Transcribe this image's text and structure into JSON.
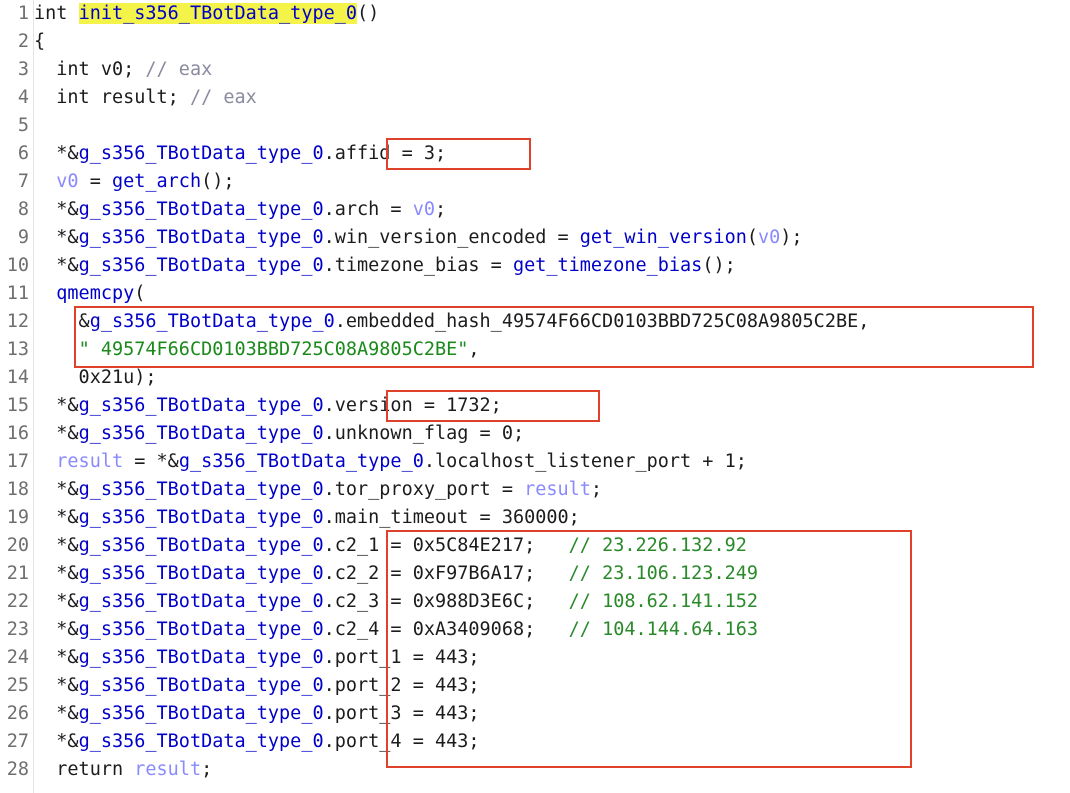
{
  "window": {
    "type": "pseudocode-view"
  },
  "colors": {
    "highlight": "#f3f34a",
    "annotation_box": "#e0412a",
    "global_symbol": "#0000c8",
    "local_var": "#8a8aff",
    "string": "#1a8a1a"
  },
  "lines": [
    {
      "n": "1"
    },
    {
      "n": "2"
    },
    {
      "n": "3"
    },
    {
      "n": "4"
    },
    {
      "n": "5"
    },
    {
      "n": "6"
    },
    {
      "n": "7"
    },
    {
      "n": "8"
    },
    {
      "n": "9"
    },
    {
      "n": "10"
    },
    {
      "n": "11"
    },
    {
      "n": "12"
    },
    {
      "n": "13"
    },
    {
      "n": "14"
    },
    {
      "n": "15"
    },
    {
      "n": "16"
    },
    {
      "n": "17"
    },
    {
      "n": "18"
    },
    {
      "n": "19"
    },
    {
      "n": "20"
    },
    {
      "n": "21"
    },
    {
      "n": "22"
    },
    {
      "n": "23"
    },
    {
      "n": "24"
    },
    {
      "n": "25"
    },
    {
      "n": "26"
    },
    {
      "n": "27"
    },
    {
      "n": "28"
    }
  ],
  "code": {
    "l1_kw": "int ",
    "l1_fn": "init_s356_TBotData_type_0",
    "l1_rest": "()",
    "l2": "{",
    "l3_a": "  int v0; ",
    "l3_c": "// eax",
    "l4_a": "  int result; ",
    "l4_c": "// eax",
    "l6_a": "  *&",
    "l6_g": "g_s356_TBotData_type_0",
    "l6_b": ".affid = 3;",
    "l7_v": "  v0",
    "l7_a": " = ",
    "l7_f": "get_arch",
    "l7_b": "();",
    "l8_a": "  *&",
    "l8_g": "g_s356_TBotData_type_0",
    "l8_b": ".arch = ",
    "l8_v": "v0",
    "l8_c": ";",
    "l9_a": "  *&",
    "l9_g": "g_s356_TBotData_type_0",
    "l9_b": ".win_version_encoded = ",
    "l9_f": "get_win_version",
    "l9_c": "(",
    "l9_v": "v0",
    "l9_d": ");",
    "l10_a": "  *&",
    "l10_g": "g_s356_TBotData_type_0",
    "l10_b": ".timezone_bias = ",
    "l10_f": "get_timezone_bias",
    "l10_c": "();",
    "l11_a": "  ",
    "l11_f": "qmemcpy",
    "l11_b": "(",
    "l12_a": "    &",
    "l12_g": "g_s356_TBotData_type_0",
    "l12_b": ".embedded_hash_49574F66CD0103BBD725C08A9805C2BE,",
    "l13_a": "    ",
    "l13_s": "\" 49574F66CD0103BBD725C08A9805C2BE\"",
    "l13_b": ",",
    "l14": "    0x21u);",
    "l15_a": "  *&",
    "l15_g": "g_s356_TBotData_type_0",
    "l15_b": ".version = 1732;",
    "l16_a": "  *&",
    "l16_g": "g_s356_TBotData_type_0",
    "l16_b": ".unknown_flag = 0;",
    "l17_v": "  result",
    "l17_a": " = *&",
    "l17_g": "g_s356_TBotData_type_0",
    "l17_b": ".localhost_listener_port + 1;",
    "l18_a": "  *&",
    "l18_g": "g_s356_TBotData_type_0",
    "l18_b": ".tor_proxy_port = ",
    "l18_v": "result",
    "l18_c": ";",
    "l19_a": "  *&",
    "l19_g": "g_s356_TBotData_type_0",
    "l19_b": ".main_timeout = 360000;",
    "l20_a": "  *&",
    "l20_g": "g_s356_TBotData_type_0",
    "l20_b": ".c2_1 = 0x5C84E217;   ",
    "l20_c": "// 23.226.132.92",
    "l21_a": "  *&",
    "l21_g": "g_s356_TBotData_type_0",
    "l21_b": ".c2_2 = 0xF97B6A17;   ",
    "l21_c": "// 23.106.123.249",
    "l22_a": "  *&",
    "l22_g": "g_s356_TBotData_type_0",
    "l22_b": ".c2_3 = 0x988D3E6C;   ",
    "l22_c": "// 108.62.141.152",
    "l23_a": "  *&",
    "l23_g": "g_s356_TBotData_type_0",
    "l23_b": ".c2_4 = 0xA3409068;   ",
    "l23_c": "// 104.144.64.163",
    "l24_a": "  *&",
    "l24_g": "g_s356_TBotData_type_0",
    "l24_b": ".port_1 = 443;",
    "l25_a": "  *&",
    "l25_g": "g_s356_TBotData_type_0",
    "l25_b": ".port_2 = 443;",
    "l26_a": "  *&",
    "l26_g": "g_s356_TBotData_type_0",
    "l26_b": ".port_3 = 443;",
    "l27_a": "  *&",
    "l27_g": "g_s356_TBotData_type_0",
    "l27_b": ".port_4 = 443;",
    "l28_a": "  return ",
    "l28_v": "result",
    "l28_b": ";"
  }
}
